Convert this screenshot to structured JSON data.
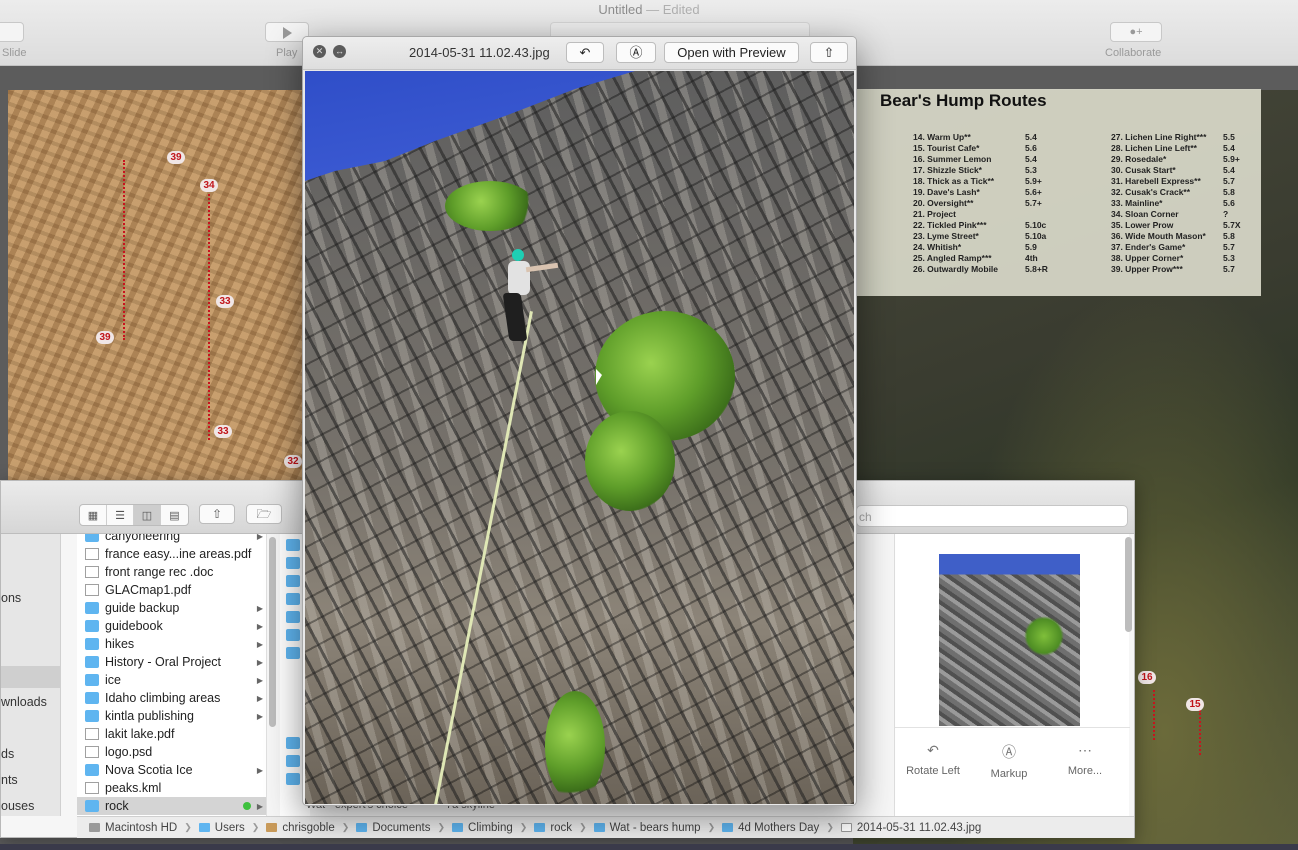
{
  "keynote": {
    "doc_title": "Untitled",
    "doc_status": "— Edited",
    "slide_label": "Slide",
    "play_label": "Play",
    "collaborate_label": "Collaborate"
  },
  "slide": {
    "routes_title": "Bear's Hump Routes",
    "routes_left": [
      {
        "name": "14. Warm Up**",
        "grade": "5.4"
      },
      {
        "name": "15. Tourist Cafe*",
        "grade": "5.6"
      },
      {
        "name": "16. Summer Lemon",
        "grade": "5.4"
      },
      {
        "name": "17. Shizzle Stick*",
        "grade": "5.3"
      },
      {
        "name": "18. Thick as a Tick**",
        "grade": "5.9+"
      },
      {
        "name": "19. Dave's Lash*",
        "grade": "5.6+"
      },
      {
        "name": "20. Oversight**",
        "grade": "5.7+"
      },
      {
        "name": "21. Project",
        "grade": ""
      },
      {
        "name": "22. Tickled Pink***",
        "grade": "5.10c"
      },
      {
        "name": "23. Lyme Street*",
        "grade": "5.10a"
      },
      {
        "name": "24. Whitish*",
        "grade": "5.9"
      },
      {
        "name": "25. Angled Ramp***",
        "grade": "4th"
      },
      {
        "name": "26. Outwardly Mobile",
        "grade": "5.8+R"
      }
    ],
    "routes_right": [
      {
        "name": "27. Lichen Line Right***",
        "grade": "5.5"
      },
      {
        "name": "28. Lichen Line Left**",
        "grade": "5.4"
      },
      {
        "name": "29. Rosedale*",
        "grade": "5.9+"
      },
      {
        "name": "30. Cusak Start*",
        "grade": "5.4"
      },
      {
        "name": "31. Harebell Express**",
        "grade": "5.7"
      },
      {
        "name": "32. Cusak's Crack**",
        "grade": "5.8"
      },
      {
        "name": "33. Mainline*",
        "grade": "5.6"
      },
      {
        "name": "34. Sloan Corner",
        "grade": "?"
      },
      {
        "name": "35. Lower Prow",
        "grade": "5.7X"
      },
      {
        "name": "36. Wide Mouth Mason*",
        "grade": "5.8"
      },
      {
        "name": "37. Ender's Game*",
        "grade": "5.7"
      },
      {
        "name": "38. Upper Corner*",
        "grade": "5.3"
      },
      {
        "name": "39. Upper Prow***",
        "grade": "5.7"
      }
    ],
    "map_markers": [
      "39",
      "34",
      "33",
      "39",
      "33",
      "32"
    ],
    "right_markers": [
      "16",
      "15"
    ]
  },
  "quicklook": {
    "filename": "2014-05-31 11.02.43.jpg",
    "open_with": "Open with Preview"
  },
  "finder": {
    "search_placeholder": "ch",
    "sidebar_items": [
      "ons",
      "wnloads",
      "ds",
      "nts",
      "ouses"
    ],
    "files": [
      {
        "name": "canyoneering",
        "type": "folder",
        "arrow": true
      },
      {
        "name": "france easy...ine areas.pdf",
        "type": "doc",
        "arrow": false
      },
      {
        "name": "front range rec .doc",
        "type": "doc",
        "arrow": false
      },
      {
        "name": "GLACmap1.pdf",
        "type": "doc",
        "arrow": false
      },
      {
        "name": "guide backup",
        "type": "folder",
        "arrow": true
      },
      {
        "name": "guidebook",
        "type": "folder",
        "arrow": true
      },
      {
        "name": "hikes",
        "type": "folder",
        "arrow": true
      },
      {
        "name": "History - Oral Project",
        "type": "folder",
        "arrow": true
      },
      {
        "name": "ice",
        "type": "folder",
        "arrow": true
      },
      {
        "name": "Idaho climbing areas",
        "type": "folder",
        "arrow": true
      },
      {
        "name": "kintla publishing",
        "type": "folder",
        "arrow": true
      },
      {
        "name": "lakit lake.pdf",
        "type": "doc",
        "arrow": false
      },
      {
        "name": "logo.psd",
        "type": "doc",
        "arrow": false
      },
      {
        "name": "Nova Scotia Ice",
        "type": "folder",
        "arrow": true
      },
      {
        "name": "peaks.kml",
        "type": "doc",
        "arrow": false
      },
      {
        "name": "rock",
        "type": "folder",
        "arrow": true,
        "selected": true,
        "tag": "green"
      }
    ],
    "col2_bottom": [
      "Wat - expert's choice",
      "7a skyline"
    ],
    "preview_actions": [
      "Rotate Left",
      "Markup",
      "More..."
    ],
    "path": [
      "Macintosh HD",
      "Users",
      "chrisgoble",
      "Documents",
      "Climbing",
      "rock",
      "Wat - bears hump",
      "4d Mothers Day",
      "2014-05-31 11.02.43.jpg"
    ]
  }
}
